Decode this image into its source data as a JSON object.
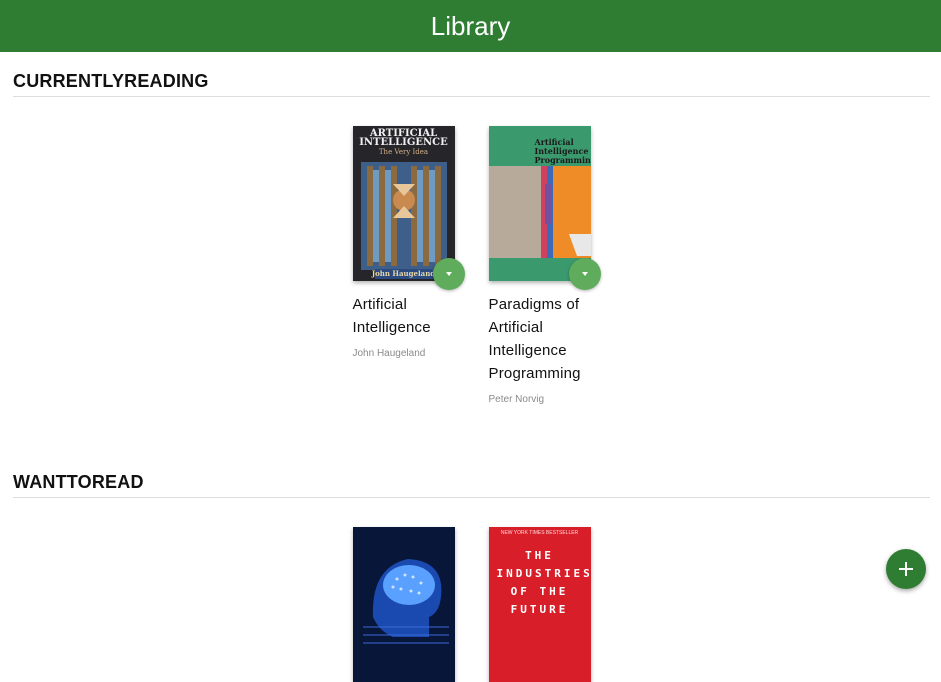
{
  "header": {
    "title": "Library"
  },
  "shelves": [
    {
      "title": "CURRENTLYREADING",
      "books": [
        {
          "title": "Artificial Intelligence",
          "author": "John Haugeland",
          "cover_title_1": "ARTIFICIAL",
          "cover_title_2": "INTELLIGENCE",
          "cover_subtitle": "The Very Idea",
          "cover_author": "John Haugeland"
        },
        {
          "title": "Paradigms of Artificial Intelligence Programming",
          "author": "Peter Norvig",
          "cover_title": "Artificial Intelligence Programming:"
        }
      ]
    },
    {
      "title": "WANTTOREAD",
      "books": [
        {
          "cover_kind": "brain"
        },
        {
          "cover_badge": "NEW YORK TIMES BESTSELLER",
          "cover_title": "THE INDUSTRIES OF THE FUTURE"
        }
      ]
    }
  ],
  "colors": {
    "header": "#2e7d32",
    "shelf_changer": "#60ac5d",
    "add_button": "#2e7d32"
  },
  "icons": {
    "shelf_changer": "caret-down-icon",
    "add": "plus-icon"
  }
}
